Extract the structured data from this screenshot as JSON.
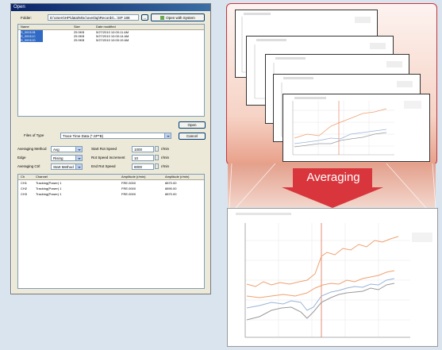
{
  "dialog": {
    "title": "Open",
    "folder_label": "Folder:",
    "folder_path": "D:\\Users\\HP\\data\\Misc\\overlap\\Records\\...\\SP 188",
    "browse_label": "...",
    "open_system_label": "Open with System",
    "file_columns": [
      "Name",
      "Size",
      "Date modified"
    ],
    "files": [
      {
        "name": "S_00011B",
        "size": "25.9KB",
        "date": "5/27/2010 10:00:11 AM"
      },
      {
        "name": "S_00011C",
        "size": "25.9KB",
        "date": "5/27/2010 10:00:14 AM"
      },
      {
        "name": "S_00011D",
        "size": "25.9KB",
        "date": "5/27/2010 10:00:19 AM"
      }
    ],
    "files_of_type_label": "Files of Type",
    "files_of_type_value": "Trace Time Data (*.SP*B)",
    "open_label": "Open",
    "cancel_label": "Cancel",
    "averaging_method_label": "Averaging Method",
    "averaging_method_value": "Avg",
    "edge_label": "Edge",
    "edge_value": "Rising",
    "averaging_ctrl_label": "Averaging Ctrl",
    "averaging_ctrl_value": "Start Method",
    "start_rot_label": "Start Rot Speed",
    "start_rot_value": "1000",
    "rot_speed_incr_label": "Rot Speed Increment",
    "rot_speed_incr_value": "10",
    "end_rot_label": "End Rot Speed",
    "end_rot_value": "8000",
    "unit": "r/min",
    "channel_columns": [
      "Ch",
      "Channel",
      "Amplitude (r/min)",
      "Amplitude (r/min)"
    ],
    "channels": [
      {
        "ch": "CH1",
        "name": "Tracking(Power) 1",
        "a": "FRE.0000",
        "b": "8870.00"
      },
      {
        "ch": "CH2",
        "name": "Tracking(Power) 1",
        "a": "FRE.0000",
        "b": "8890.00"
      },
      {
        "ch": "CH3",
        "name": "Tracking(Power) 1",
        "a": "FRE.0000",
        "b": "8870.00"
      }
    ]
  },
  "averaging_label": "Averaging",
  "colors": {
    "highlight_border": "#c8343a",
    "arrow": "#d8363c",
    "series_orange": "#f0a070",
    "series_blue": "#9ab4d8",
    "series_gray": "#9a9a9a",
    "marker_line": "#e07050"
  }
}
